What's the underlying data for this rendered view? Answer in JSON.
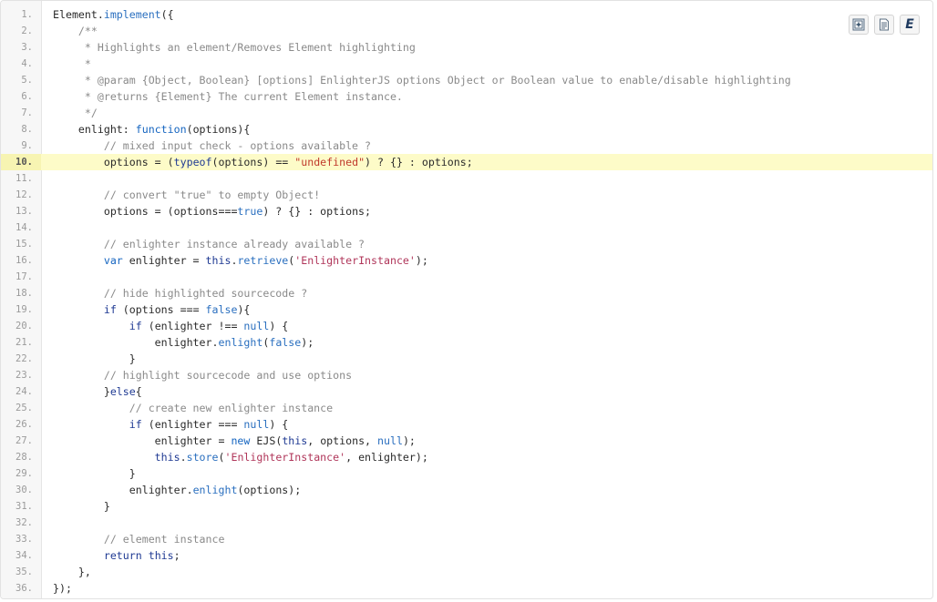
{
  "toolbar": {
    "buttons": [
      {
        "icon": "expand-code-icon"
      },
      {
        "icon": "raw-source-icon"
      },
      {
        "icon": "enlighterjs-logo-icon",
        "label": "E"
      }
    ]
  },
  "highlighted_line": 10,
  "lines": [
    {
      "n": "1.",
      "tokens": [
        [
          "t-text",
          "Element."
        ],
        [
          "t-fn",
          "implement"
        ],
        [
          "t-pun",
          "({"
        ]
      ]
    },
    {
      "n": "2.",
      "tokens": [
        [
          "t-cm",
          "    /**"
        ]
      ]
    },
    {
      "n": "3.",
      "tokens": [
        [
          "t-cm",
          "     * Highlights an element/Removes Element highlighting"
        ]
      ]
    },
    {
      "n": "4.",
      "tokens": [
        [
          "t-cm",
          "     *"
        ]
      ]
    },
    {
      "n": "5.",
      "tokens": [
        [
          "t-cm",
          "     * @param {Object, Boolean} [options] EnlighterJS options Object or Boolean value to enable/disable highlighting"
        ]
      ]
    },
    {
      "n": "6.",
      "tokens": [
        [
          "t-cm",
          "     * @returns {Element} The current Element instance."
        ]
      ]
    },
    {
      "n": "7.",
      "tokens": [
        [
          "t-cm",
          "     */"
        ]
      ]
    },
    {
      "n": "8.",
      "tokens": [
        [
          "t-text",
          "    enlight: "
        ],
        [
          "t-kw2",
          "function"
        ],
        [
          "t-pun",
          "(options){"
        ]
      ]
    },
    {
      "n": "9.",
      "tokens": [
        [
          "t-cm",
          "        // mixed input check - options available ?"
        ]
      ]
    },
    {
      "n": "10.",
      "tokens": [
        [
          "t-text",
          "        options = ("
        ],
        [
          "t-kw",
          "typeof"
        ],
        [
          "t-text",
          "(options) == "
        ],
        [
          "t-str",
          "\"undefined\""
        ],
        [
          "t-text",
          ") ? {} : options;"
        ]
      ]
    },
    {
      "n": "11.",
      "tokens": []
    },
    {
      "n": "12.",
      "tokens": [
        [
          "t-cm",
          "        // convert \"true\" to empty Object!"
        ]
      ]
    },
    {
      "n": "13.",
      "tokens": [
        [
          "t-text",
          "        options = (options==="
        ],
        [
          "t-bool",
          "true"
        ],
        [
          "t-text",
          ") ? {} : options;"
        ]
      ]
    },
    {
      "n": "14.",
      "tokens": []
    },
    {
      "n": "15.",
      "tokens": [
        [
          "t-cm",
          "        // enlighter instance already available ?"
        ]
      ]
    },
    {
      "n": "16.",
      "tokens": [
        [
          "t-kw2",
          "        var"
        ],
        [
          "t-text",
          " enlighter = "
        ],
        [
          "t-kw",
          "this"
        ],
        [
          "t-text",
          "."
        ],
        [
          "t-fn",
          "retrieve"
        ],
        [
          "t-text",
          "("
        ],
        [
          "t-str2",
          "'EnlighterInstance'"
        ],
        [
          "t-text",
          ");"
        ]
      ]
    },
    {
      "n": "17.",
      "tokens": []
    },
    {
      "n": "18.",
      "tokens": [
        [
          "t-cm",
          "        // hide highlighted sourcecode ?"
        ]
      ]
    },
    {
      "n": "19.",
      "tokens": [
        [
          "t-kw",
          "        if"
        ],
        [
          "t-text",
          " (options === "
        ],
        [
          "t-bool",
          "false"
        ],
        [
          "t-text",
          "){"
        ]
      ]
    },
    {
      "n": "20.",
      "tokens": [
        [
          "t-kw",
          "            if"
        ],
        [
          "t-text",
          " (enlighter !== "
        ],
        [
          "t-bool",
          "null"
        ],
        [
          "t-text",
          ") {"
        ]
      ]
    },
    {
      "n": "21.",
      "tokens": [
        [
          "t-text",
          "                enlighter."
        ],
        [
          "t-fn",
          "enlight"
        ],
        [
          "t-text",
          "("
        ],
        [
          "t-bool",
          "false"
        ],
        [
          "t-text",
          ");"
        ]
      ]
    },
    {
      "n": "22.",
      "tokens": [
        [
          "t-text",
          "            }"
        ]
      ]
    },
    {
      "n": "23.",
      "tokens": [
        [
          "t-cm",
          "        // highlight sourcecode and use options"
        ]
      ]
    },
    {
      "n": "24.",
      "tokens": [
        [
          "t-text",
          "        }"
        ],
        [
          "t-kw",
          "else"
        ],
        [
          "t-text",
          "{"
        ]
      ]
    },
    {
      "n": "25.",
      "tokens": [
        [
          "t-cm",
          "            // create new enlighter instance"
        ]
      ]
    },
    {
      "n": "26.",
      "tokens": [
        [
          "t-kw",
          "            if"
        ],
        [
          "t-text",
          " (enlighter === "
        ],
        [
          "t-bool",
          "null"
        ],
        [
          "t-text",
          ") {"
        ]
      ]
    },
    {
      "n": "27.",
      "tokens": [
        [
          "t-text",
          "                enlighter = "
        ],
        [
          "t-kw2",
          "new"
        ],
        [
          "t-text",
          " EJS("
        ],
        [
          "t-kw",
          "this"
        ],
        [
          "t-text",
          ", options, "
        ],
        [
          "t-bool",
          "null"
        ],
        [
          "t-text",
          ");"
        ]
      ]
    },
    {
      "n": "28.",
      "tokens": [
        [
          "t-kw",
          "                this"
        ],
        [
          "t-text",
          "."
        ],
        [
          "t-fn",
          "store"
        ],
        [
          "t-text",
          "("
        ],
        [
          "t-str2",
          "'EnlighterInstance'"
        ],
        [
          "t-text",
          ", enlighter);"
        ]
      ]
    },
    {
      "n": "29.",
      "tokens": [
        [
          "t-text",
          "            }"
        ]
      ]
    },
    {
      "n": "30.",
      "tokens": [
        [
          "t-text",
          "            enlighter."
        ],
        [
          "t-fn",
          "enlight"
        ],
        [
          "t-text",
          "(options);"
        ]
      ]
    },
    {
      "n": "31.",
      "tokens": [
        [
          "t-text",
          "        }"
        ]
      ]
    },
    {
      "n": "32.",
      "tokens": []
    },
    {
      "n": "33.",
      "tokens": [
        [
          "t-cm",
          "        // element instance"
        ]
      ]
    },
    {
      "n": "34.",
      "tokens": [
        [
          "t-kw",
          "        return"
        ],
        [
          "t-text",
          " "
        ],
        [
          "t-kw",
          "this"
        ],
        [
          "t-text",
          ";"
        ]
      ]
    },
    {
      "n": "35.",
      "tokens": [
        [
          "t-text",
          "    },"
        ]
      ]
    },
    {
      "n": "36.",
      "tokens": [
        [
          "t-text",
          "});"
        ]
      ]
    }
  ]
}
